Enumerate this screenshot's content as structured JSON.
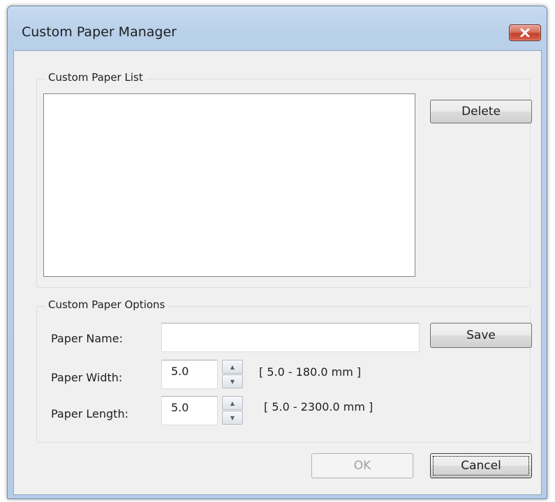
{
  "window": {
    "title": "Custom Paper Manager",
    "close_icon": "close-x-icon"
  },
  "list_group": {
    "label": "Custom Paper List",
    "items": [],
    "delete_label": "Delete"
  },
  "options_group": {
    "label": "Custom Paper Options",
    "name_label": "Paper Name:",
    "name_value": "",
    "save_label": "Save",
    "width_label": "Paper Width:",
    "width_value": "5.0",
    "width_range": "[ 5.0 - 180.0 mm ]",
    "length_label": "Paper Length:",
    "length_value": "5.0",
    "length_range": "[ 5.0 - 2300.0 mm ]"
  },
  "buttons": {
    "ok_label": "OK",
    "cancel_label": "Cancel"
  },
  "colors": {
    "title_bar": "#b9d0ea",
    "close_button": "#c2402a",
    "dialog_bg": "#f0f0f0"
  }
}
